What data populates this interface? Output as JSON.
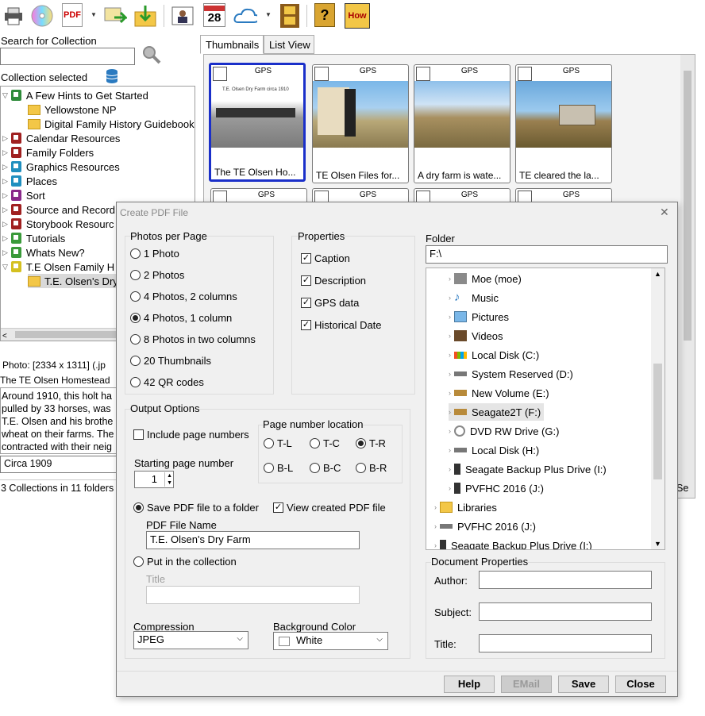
{
  "toolbar": {
    "icons": [
      "printer-icon",
      "disc-icon",
      "pdf-icon",
      "export-icon",
      "import-icon",
      "album-icon",
      "calendar-icon",
      "cloud-icon",
      "film-icon",
      "help-icon",
      "how-icon"
    ],
    "pdf_label": "PDF",
    "calendar_day": "28",
    "how_label": "How",
    "help_label": "?"
  },
  "left": {
    "search_label": "Search for Collection",
    "collection_selected_label": "Collection selected",
    "tree": [
      {
        "label": "A Few Hints to Get Started",
        "color": "#2e8b3a",
        "type": "book",
        "expanded": true
      },
      {
        "label": "Yellowstone NP",
        "type": "folder"
      },
      {
        "label": "Digital Family History Guidebook",
        "type": "folder"
      },
      {
        "label": "Calendar Resources",
        "color": "#a02020",
        "type": "book"
      },
      {
        "label": "Family Folders",
        "color": "#a02020",
        "type": "book"
      },
      {
        "label": "Graphics Resources",
        "color": "#1f8fbf",
        "type": "book"
      },
      {
        "label": "Places",
        "color": "#1f8fbf",
        "type": "book"
      },
      {
        "label": "Sort",
        "color": "#8a2a8a",
        "type": "book"
      },
      {
        "label": "Source and Record",
        "color": "#a02020",
        "type": "book"
      },
      {
        "label": "Storybook Resourc",
        "color": "#a02020",
        "type": "book"
      },
      {
        "label": "Tutorials",
        "color": "#3a9a3a",
        "type": "book"
      },
      {
        "label": "Whats New?",
        "color": "#3a9a3a",
        "type": "book"
      },
      {
        "label": "T.E Olsen Family H",
        "color": "#d4c020",
        "type": "book",
        "expanded": true
      },
      {
        "label": "T.E. Olsen's Dry",
        "type": "folder",
        "selected": true
      }
    ],
    "photo_info": "Photo: [2334 x 1311]  (.jp",
    "photo_title": "The TE Olsen Homestead",
    "description_lines": [
      "Around 1910, this holt ha",
      "pulled by 33 horses, was",
      "T.E. Olsen and his brothe",
      "wheat on their farms. The",
      "contracted with their neig"
    ],
    "date_value": "Circa 1909",
    "status": "3 Collections in 11 folders"
  },
  "right": {
    "tabs": [
      "Thumbnails",
      "List View"
    ],
    "thumbnails": [
      {
        "caption": "The TE Olsen Ho...",
        "gps": "GPS",
        "selected": true,
        "inner_text": "T.E. Olsen Dry Farm circa 1910"
      },
      {
        "caption": "TE Olsen Files for...",
        "gps": "GPS"
      },
      {
        "caption": "A dry farm is wate...",
        "gps": "GPS"
      },
      {
        "caption": "TE cleared the la...",
        "gps": "GPS"
      },
      {
        "caption": "",
        "gps": "GPS"
      },
      {
        "caption": "",
        "gps": "GPS"
      },
      {
        "caption": "",
        "gps": "GPS"
      },
      {
        "caption": "",
        "gps": "GPS"
      }
    ],
    "status_fragment": "Se"
  },
  "dialog": {
    "title": "Create PDF File",
    "close": "✕",
    "photos_per_page": {
      "title": "Photos per Page",
      "options": [
        "1 Photo",
        "2 Photos",
        "4 Photos, 2 columns",
        "4 Photos, 1 column",
        "8 Photos in two columns",
        "20 Thumbnails",
        "42 QR codes"
      ],
      "selected": "4 Photos, 1 column"
    },
    "properties": {
      "title": "Properties",
      "items": [
        {
          "label": "Caption",
          "checked": true
        },
        {
          "label": "Description",
          "checked": true
        },
        {
          "label": "GPS data",
          "checked": true
        },
        {
          "label": "Historical Date",
          "checked": true
        }
      ]
    },
    "folder": {
      "label": "Folder",
      "path": "F:\\",
      "items": [
        {
          "label": "Moe (moe)",
          "indent": 1
        },
        {
          "label": "Music",
          "indent": 1
        },
        {
          "label": "Pictures",
          "indent": 1
        },
        {
          "label": "Videos",
          "indent": 1
        },
        {
          "label": "Local Disk (C:)",
          "indent": 1
        },
        {
          "label": "System Reserved (D:)",
          "indent": 1
        },
        {
          "label": "New Volume (E:)",
          "indent": 1
        },
        {
          "label": "Seagate2T (F:)",
          "indent": 1,
          "selected": true
        },
        {
          "label": "DVD RW Drive (G:)",
          "indent": 1
        },
        {
          "label": "Local Disk (H:)",
          "indent": 1
        },
        {
          "label": "Seagate Backup Plus Drive (I:)",
          "indent": 1
        },
        {
          "label": "PVFHC 2016 (J:)",
          "indent": 1
        },
        {
          "label": "Libraries",
          "indent": 0
        },
        {
          "label": "PVFHC 2016 (J:)",
          "indent": 0
        },
        {
          "label": "Seagate Backup Plus Drive (I:)",
          "indent": 0
        }
      ]
    },
    "output": {
      "title": "Output Options",
      "include_page_numbers": "Include page numbers",
      "include_checked": false,
      "page_location_title": "Page number location",
      "page_locations": [
        "T-L",
        "T-C",
        "T-R",
        "B-L",
        "B-C",
        "B-R"
      ],
      "page_location_selected": "T-R",
      "starting_page_label": "Starting page number",
      "starting_page_value": "1",
      "save_folder_label": "Save PDF file to a folder",
      "view_created_label": "View created PDF file",
      "view_created_checked": true,
      "file_name_label": "PDF File Name",
      "file_name_value": "T.E. Olsen's Dry Farm",
      "put_collection_label": "Put in the collection",
      "title_label": "Title",
      "title_value": "",
      "compression_label": "Compression",
      "compression_value": "JPEG",
      "background_label": "Background Color",
      "background_value": "White"
    },
    "doc_props": {
      "title": "Document Properties",
      "author_label": "Author:",
      "subject_label": "Subject:",
      "title_label": "Title:",
      "author_value": "",
      "subject_value": "",
      "title_value": ""
    },
    "buttons": {
      "help": "Help",
      "email": "EMail",
      "save": "Save",
      "close": "Close"
    }
  }
}
